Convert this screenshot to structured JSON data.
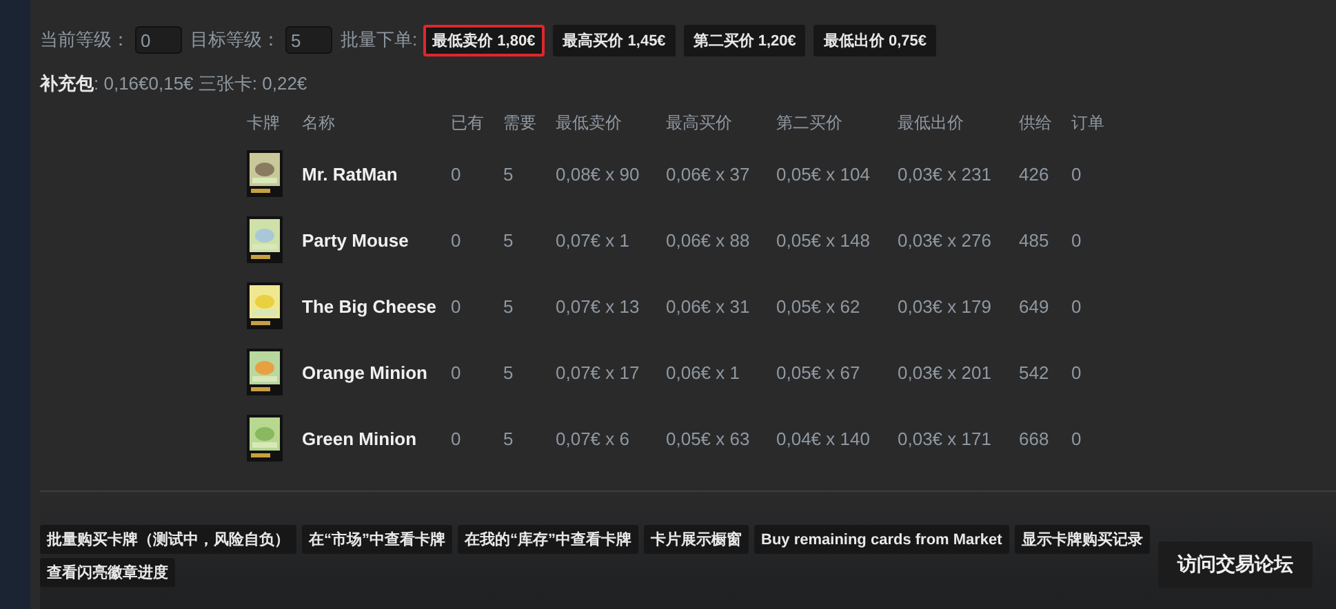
{
  "levels": {
    "current_label": "当前等级：",
    "current_value": "0",
    "target_label": "目标等级：",
    "target_value": "5",
    "batch_label": "批量下单:"
  },
  "batch_buttons": [
    {
      "label": "最低卖价 1,80€",
      "selected": true
    },
    {
      "label": "最高买价 1,45€",
      "selected": false
    },
    {
      "label": "第二买价 1,20€",
      "selected": false
    },
    {
      "label": "最低出价 0,75€",
      "selected": false
    }
  ],
  "booster": {
    "label": "补充包",
    "value": ": 0,16€0,15€ 三张卡: 0,22€"
  },
  "table": {
    "columns": [
      "卡牌",
      "名称",
      "已有",
      "需要",
      "最低卖价",
      "最高买价",
      "第二买价",
      "最低出价",
      "供给",
      "订单"
    ],
    "rows": [
      {
        "name": "Mr. RatMan",
        "owned": "0",
        "needed": "5",
        "lowest_sell": "0,08€ x 90",
        "highest_buy": "0,06€ x 37",
        "second_buy": "0,05€ x 104",
        "lowest_offer": "0,03€ x 231",
        "supply": "426",
        "orders": "0"
      },
      {
        "name": "Party Mouse",
        "owned": "0",
        "needed": "5",
        "lowest_sell": "0,07€ x 1",
        "highest_buy": "0,06€ x 88",
        "second_buy": "0,05€ x 148",
        "lowest_offer": "0,03€ x 276",
        "supply": "485",
        "orders": "0"
      },
      {
        "name": "The Big Cheese",
        "owned": "0",
        "needed": "5",
        "lowest_sell": "0,07€ x 13",
        "highest_buy": "0,06€ x 31",
        "second_buy": "0,05€ x 62",
        "lowest_offer": "0,03€ x 179",
        "supply": "649",
        "orders": "0"
      },
      {
        "name": "Orange Minion",
        "owned": "0",
        "needed": "5",
        "lowest_sell": "0,07€ x 17",
        "highest_buy": "0,06€ x 1",
        "second_buy": "0,05€ x 67",
        "lowest_offer": "0,03€ x 201",
        "supply": "542",
        "orders": "0"
      },
      {
        "name": "Green Minion",
        "owned": "0",
        "needed": "5",
        "lowest_sell": "0,07€ x 6",
        "highest_buy": "0,05€ x 63",
        "second_buy": "0,04€ x 140",
        "lowest_offer": "0,03€ x 171",
        "supply": "668",
        "orders": "0"
      }
    ]
  },
  "action_buttons": [
    "批量购买卡牌（测试中，风险自负）",
    "在“市场”中查看卡牌",
    "在我的“库存”中查看卡牌",
    "卡片展示橱窗",
    "Buy remaining cards from Market",
    "显示卡牌购买记录",
    "查看闪亮徽章进度"
  ],
  "forum_button": "访问交易论坛"
}
